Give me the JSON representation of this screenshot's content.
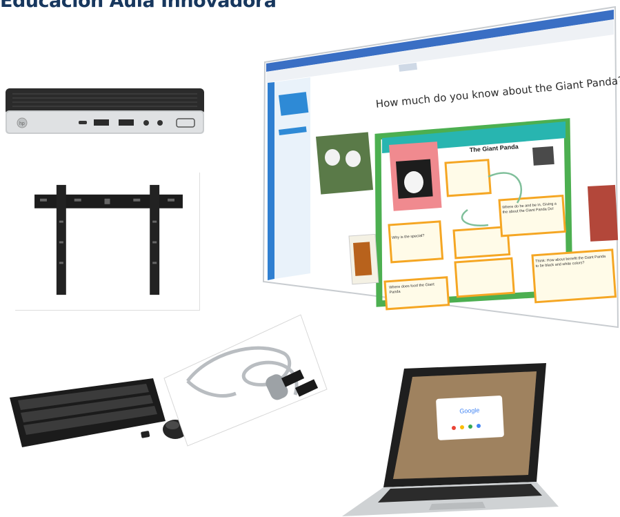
{
  "page": {
    "title": "Educación Aula Innovadora"
  },
  "whiteboard": {
    "heading": "How much do you know about the Giant Panda?",
    "card_title": "The Giant Panda",
    "note_1": "Think: How about benefit the Giant Panda to be black and white colors?",
    "note_2": "Where do he and be in, Giving a the about the Giant Panda Do!",
    "note_3": "Why is the special?",
    "note_4": "Where does food the Giant Panda"
  },
  "laptop": {
    "screen_text": "Google"
  },
  "colors": {
    "title": "#17375e",
    "green_frame": "#4caf50",
    "teal_frame": "#28b5b0",
    "orange_card": "#f5a623",
    "laptop_body": "#2a2a2a"
  }
}
